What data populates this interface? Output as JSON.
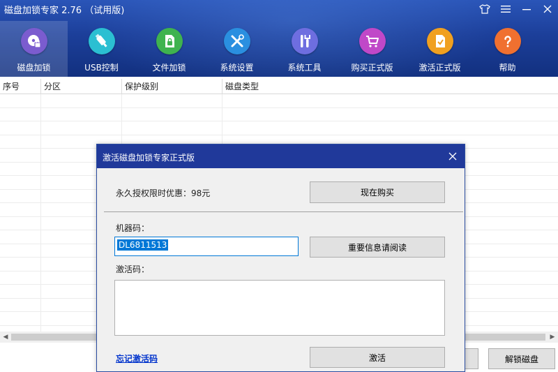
{
  "app": {
    "title": "磁盘加锁专家 2.76 （试用版)",
    "window_controls": [
      "shirt-icon",
      "menu-icon",
      "minimize-icon",
      "close-icon"
    ]
  },
  "toolbar": {
    "items": [
      {
        "label": "磁盘加锁",
        "icon": "disk-lock-icon",
        "color": "#7b5ccf",
        "active": true
      },
      {
        "label": "USB控制",
        "icon": "usb-icon",
        "color": "#2bbfd2",
        "active": false
      },
      {
        "label": "文件加锁",
        "icon": "file-lock-icon",
        "color": "#3fb34f",
        "active": false
      },
      {
        "label": "系统设置",
        "icon": "tools-icon",
        "color": "#2a8fe0",
        "active": false
      },
      {
        "label": "系统工具",
        "icon": "wrench-icon",
        "color": "#6e6ee0",
        "active": false
      },
      {
        "label": "购买正式版",
        "icon": "cart-icon",
        "color": "#c048c8",
        "active": false
      },
      {
        "label": "激活正式版",
        "icon": "activate-icon",
        "color": "#f0a020",
        "active": false
      },
      {
        "label": "帮助",
        "icon": "help-icon",
        "color": "#f07030",
        "active": false
      }
    ]
  },
  "table": {
    "columns": [
      "序号",
      "分区",
      "保护级别",
      "磁盘类型"
    ],
    "rows": []
  },
  "bottom_buttons": {
    "unlock": "解锁磁盘"
  },
  "dialog": {
    "title": "激活磁盘加锁专家正式版",
    "license_text": "永久授权限时优惠：98元",
    "buy_now": "现在购买",
    "machine_code_label": "机器码：",
    "machine_code_value": "DL6811513",
    "read_info": "重要信息请阅读",
    "activation_code_label": "激活码：",
    "activation_code_value": "",
    "forgot_link": "忘记激活码",
    "activate": "激活"
  }
}
